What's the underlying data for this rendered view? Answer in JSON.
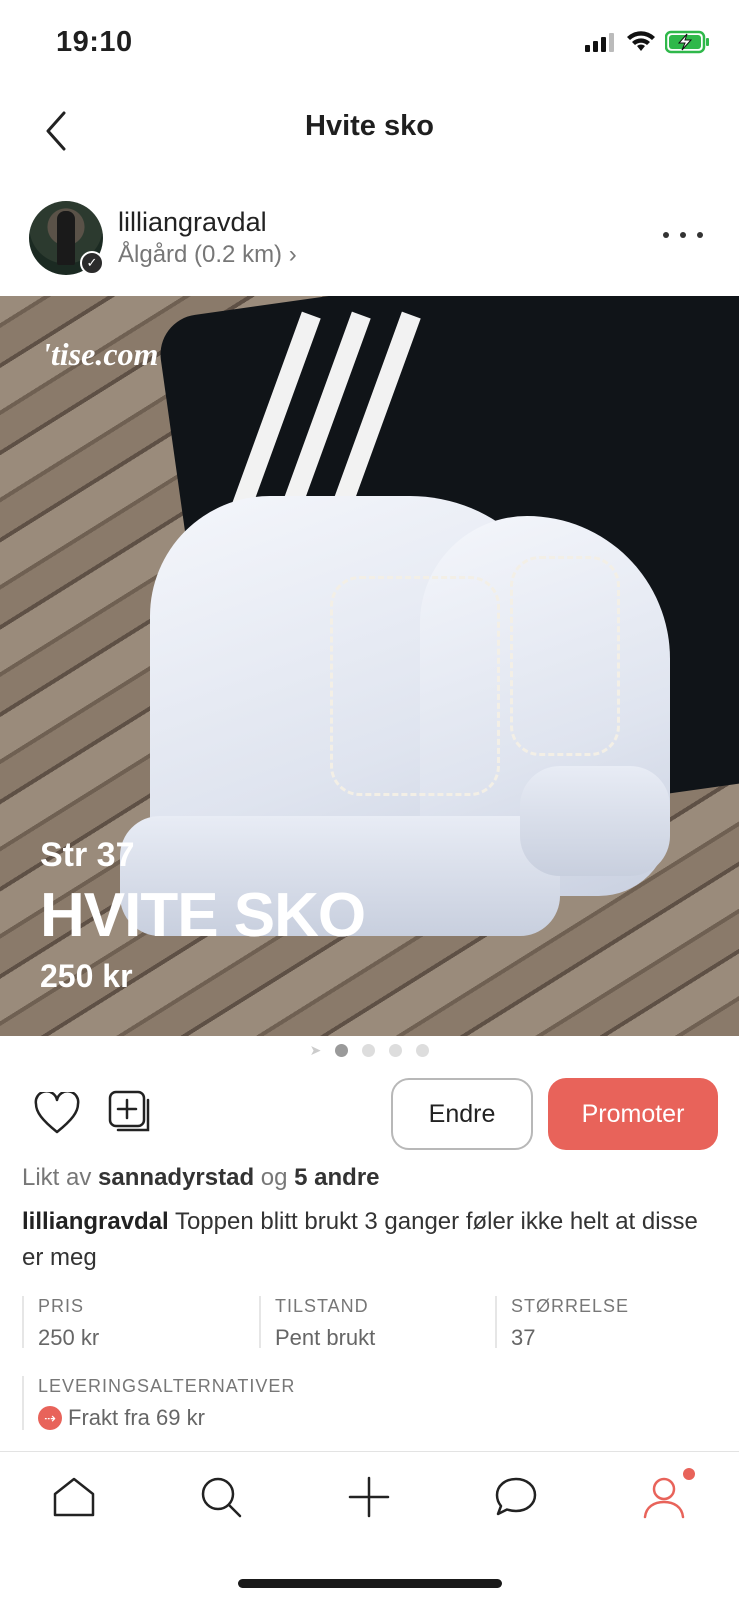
{
  "status_bar": {
    "time": "19:10",
    "icons": [
      "cellular-signal-icon",
      "wifi-icon",
      "battery-charging-icon"
    ]
  },
  "header": {
    "title": "Hvite sko",
    "back_icon": "chevron-left-icon"
  },
  "seller": {
    "username": "lilliangravdal",
    "location": "Ålgård (0.2 km) ›",
    "verified_icon": "checkmark-icon"
  },
  "image_overlay": {
    "watermark": "'tise.com",
    "size_text": "Str 37",
    "title_text": "HVITE SKO",
    "price_text": "250 kr"
  },
  "carousel": {
    "pages": 4,
    "active": 1,
    "location_icon": "location-arrow-icon"
  },
  "actions": {
    "edit_label": "Endre",
    "promote_label": "Promoter"
  },
  "likes": {
    "prefix": "Likt av",
    "user": "sannadyrstad",
    "joiner": "og",
    "others": "5 andre"
  },
  "description": {
    "user": "lilliangravdal",
    "text": " Toppen blitt brukt 3 ganger føler ikke helt at disse er meg"
  },
  "details": [
    {
      "label": "PRIS",
      "value": "250 kr"
    },
    {
      "label": "TILSTAND",
      "value": "Pent brukt"
    },
    {
      "label": "STØRRELSE",
      "value": "37"
    }
  ],
  "delivery": {
    "label": "LEVERINGSALTERNATIVER",
    "value": "Frakt fra 69 kr"
  },
  "tab_bar": {
    "items": [
      "home-icon",
      "search-icon",
      "plus-icon",
      "chat-bubble-icon",
      "profile-icon"
    ]
  },
  "colors": {
    "accent": "#e8635a",
    "text": "#222222",
    "muted": "#777777"
  }
}
